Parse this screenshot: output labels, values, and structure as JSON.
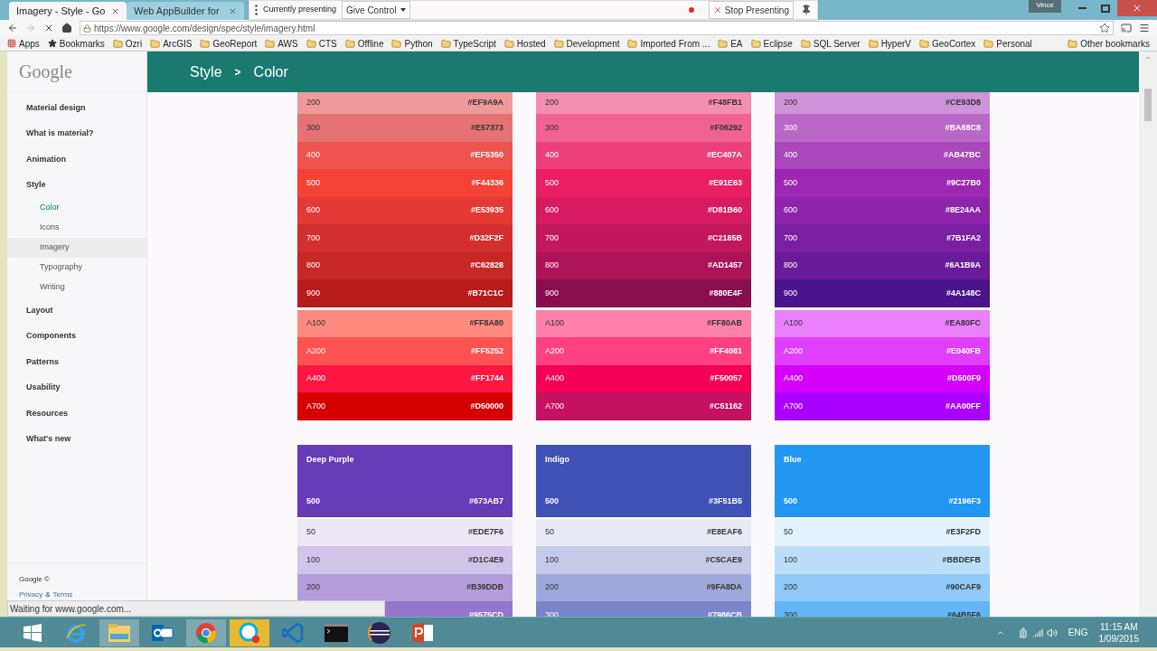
{
  "browser": {
    "tabs": [
      {
        "title": "Imagery - Style - Go",
        "selected": true
      },
      {
        "title": "Web AppBuilder for",
        "selected": false
      }
    ],
    "user": "Vince",
    "url": "https://www.google.com/design/spec/style/imagery.html",
    "bookmarks": [
      {
        "label": "Apps",
        "kind": "apps"
      },
      {
        "label": "Bookmarks",
        "kind": "star"
      },
      {
        "label": "Ozri",
        "kind": "folder"
      },
      {
        "label": "ArcGIS",
        "kind": "folder"
      },
      {
        "label": "GeoReport",
        "kind": "folder"
      },
      {
        "label": "AWS",
        "kind": "folder"
      },
      {
        "label": "CTS",
        "kind": "folder"
      },
      {
        "label": "Offline",
        "kind": "folder"
      },
      {
        "label": "Python",
        "kind": "folder"
      },
      {
        "label": "TypeScript",
        "kind": "folder"
      },
      {
        "label": "Hosted",
        "kind": "folder"
      },
      {
        "label": "Development",
        "kind": "folder"
      },
      {
        "label": "Imported From ...",
        "kind": "folder"
      },
      {
        "label": "EA",
        "kind": "folder"
      },
      {
        "label": "Eclipse",
        "kind": "folder"
      },
      {
        "label": "SQL Server",
        "kind": "folder"
      },
      {
        "label": "HyperV",
        "kind": "folder"
      },
      {
        "label": "GeoCortex",
        "kind": "folder"
      },
      {
        "label": "Personal",
        "kind": "folder"
      }
    ],
    "other_bookmarks": "Other bookmarks",
    "status": "Waiting for www.google.com..."
  },
  "presenting": {
    "label": "Currently presenting",
    "give_control": "Give Control",
    "stop": "Stop Presenting"
  },
  "sidebar": {
    "logo": "Google",
    "items": [
      {
        "label": "Material design",
        "selected": false,
        "highlighted": false
      },
      {
        "label": "What is material?",
        "selected": false,
        "highlighted": false
      },
      {
        "label": "Animation",
        "selected": false,
        "highlighted": false
      },
      {
        "label": "Style",
        "selected": false,
        "highlighted": false,
        "children": [
          {
            "label": "Color",
            "selected": true,
            "highlighted": false
          },
          {
            "label": "Icons",
            "selected": false,
            "highlighted": false
          },
          {
            "label": "Imagery",
            "selected": false,
            "highlighted": true
          },
          {
            "label": "Typography",
            "selected": false,
            "highlighted": false
          },
          {
            "label": "Writing",
            "selected": false,
            "highlighted": false
          }
        ]
      },
      {
        "label": "Layout",
        "selected": false,
        "highlighted": false
      },
      {
        "label": "Components",
        "selected": false,
        "highlighted": false
      },
      {
        "label": "Patterns",
        "selected": false,
        "highlighted": false
      },
      {
        "label": "Usability",
        "selected": false,
        "highlighted": false
      },
      {
        "label": "Resources",
        "selected": false,
        "highlighted": false
      },
      {
        "label": "What's new",
        "selected": false,
        "highlighted": false
      }
    ],
    "footer": {
      "copyright": "Google ©",
      "privacy": "Privacy",
      "amp": "&",
      "terms": "Terms"
    }
  },
  "header": {
    "section": "Style",
    "separator": ">",
    "page": "Color"
  },
  "groups": [
    {
      "columns": [
        {
          "shades": [
            {
              "shade": "200",
              "hex": "#EF9A9A",
              "light": true
            },
            {
              "shade": "300",
              "hex": "#E57373",
              "light": true
            },
            {
              "shade": "400",
              "hex": "#EF5350",
              "light": false
            },
            {
              "shade": "500",
              "hex": "#F44336",
              "light": false
            },
            {
              "shade": "600",
              "hex": "#E53935",
              "light": false
            },
            {
              "shade": "700",
              "hex": "#D32F2F",
              "light": false
            },
            {
              "shade": "800",
              "hex": "#C62828",
              "light": false
            },
            {
              "shade": "900",
              "hex": "#B71C1C",
              "light": false
            }
          ],
          "accents": [
            {
              "shade": "A100",
              "hex": "#FF8A80",
              "light": true
            },
            {
              "shade": "A200",
              "hex": "#FF5252",
              "light": false
            },
            {
              "shade": "A400",
              "hex": "#FF1744",
              "light": false
            },
            {
              "shade": "A700",
              "hex": "#D50000",
              "light": false
            }
          ]
        },
        {
          "shades": [
            {
              "shade": "200",
              "hex": "#F48FB1",
              "light": true
            },
            {
              "shade": "300",
              "hex": "#F06292",
              "light": true
            },
            {
              "shade": "400",
              "hex": "#EC407A",
              "light": false
            },
            {
              "shade": "500",
              "hex": "#E91E63",
              "light": false
            },
            {
              "shade": "600",
              "hex": "#D81B60",
              "light": false
            },
            {
              "shade": "700",
              "hex": "#C2185B",
              "light": false
            },
            {
              "shade": "800",
              "hex": "#AD1457",
              "light": false
            },
            {
              "shade": "900",
              "hex": "#880E4F",
              "light": false
            }
          ],
          "accents": [
            {
              "shade": "A100",
              "hex": "#FF80AB",
              "light": true
            },
            {
              "shade": "A200",
              "hex": "#FF4081",
              "light": false
            },
            {
              "shade": "A400",
              "hex": "#F50057",
              "light": false
            },
            {
              "shade": "A700",
              "hex": "#C51162",
              "light": false
            }
          ]
        },
        {
          "shades": [
            {
              "shade": "200",
              "hex": "#CE93D8",
              "light": true
            },
            {
              "shade": "300",
              "hex": "#BA68C8",
              "light": false
            },
            {
              "shade": "400",
              "hex": "#AB47BC",
              "light": false
            },
            {
              "shade": "500",
              "hex": "#9C27B0",
              "light": false
            },
            {
              "shade": "600",
              "hex": "#8E24AA",
              "light": false
            },
            {
              "shade": "700",
              "hex": "#7B1FA2",
              "light": false
            },
            {
              "shade": "800",
              "hex": "#6A1B9A",
              "light": false
            },
            {
              "shade": "900",
              "hex": "#4A148C",
              "light": false
            }
          ],
          "accents": [
            {
              "shade": "A100",
              "hex": "#EA80FC",
              "light": true
            },
            {
              "shade": "A200",
              "hex": "#E040FB",
              "light": false
            },
            {
              "shade": "A400",
              "hex": "#D500F9",
              "light": false
            },
            {
              "shade": "A700",
              "hex": "#AA00FF",
              "light": false
            }
          ]
        }
      ]
    },
    {
      "columns": [
        {
          "name": "Deep Purple",
          "main": {
            "shade": "500",
            "hex": "#673AB7"
          },
          "shades": [
            {
              "shade": "50",
              "hex": "#EDE7F6",
              "light": true
            },
            {
              "shade": "100",
              "hex": "#D1C4E9",
              "light": true
            },
            {
              "shade": "200",
              "hex": "#B39DDB",
              "light": true
            },
            {
              "hex": "#9575CD",
              "light": false
            }
          ]
        },
        {
          "name": "Indigo",
          "main": {
            "shade": "500",
            "hex": "#3F51B5"
          },
          "shades": [
            {
              "shade": "50",
              "hex": "#E8EAF6",
              "light": true
            },
            {
              "shade": "100",
              "hex": "#C5CAE9",
              "light": true
            },
            {
              "shade": "200",
              "hex": "#9FA8DA",
              "light": true
            },
            {
              "shade": "300",
              "hex": "#7986CB",
              "light": false
            }
          ]
        },
        {
          "name": "Blue",
          "main": {
            "shade": "500",
            "hex": "#2196F3"
          },
          "shades": [
            {
              "shade": "50",
              "hex": "#E3F2FD",
              "light": true
            },
            {
              "shade": "100",
              "hex": "#BBDEFB",
              "light": true
            },
            {
              "shade": "200",
              "hex": "#90CAF9",
              "light": true
            },
            {
              "shade": "300",
              "hex": "#64B5F6",
              "light": true
            }
          ]
        }
      ]
    }
  ],
  "taskbar": {
    "apps": [
      {
        "kind": "start"
      },
      {
        "kind": "ie"
      },
      {
        "kind": "explorer"
      },
      {
        "kind": "outlook"
      },
      {
        "kind": "chrome"
      },
      {
        "kind": "skype"
      },
      {
        "kind": "vscode"
      },
      {
        "kind": "console"
      },
      {
        "kind": "eclipse"
      },
      {
        "kind": "powerpoint"
      }
    ],
    "language": "ENG",
    "time": "11:15 AM",
    "date": "1/09/2015"
  }
}
